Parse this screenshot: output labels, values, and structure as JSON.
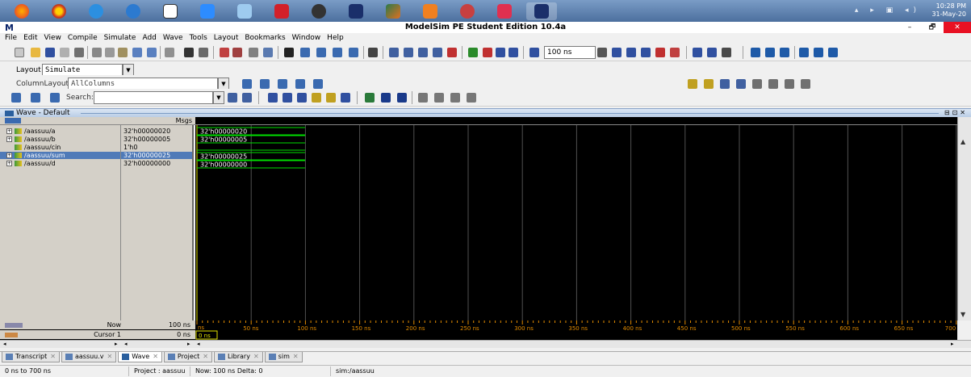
{
  "clock": {
    "time": "10:28 PM",
    "date": "31-May-20"
  },
  "window": {
    "icon": "M",
    "title": "ModelSim PE Student Edition 10.4a",
    "minimize": "–",
    "maximize": "🗗",
    "close": "✕"
  },
  "menu": [
    "File",
    "Edit",
    "View",
    "Compile",
    "Simulate",
    "Add",
    "Wave",
    "Tools",
    "Layout",
    "Bookmarks",
    "Window",
    "Help"
  ],
  "toolbar": {
    "run_length": "100 ns"
  },
  "layout": {
    "label": "Layout",
    "value": "Simulate"
  },
  "column_layout": {
    "label": "ColumnLayout",
    "value": "AllColumns"
  },
  "search": {
    "label": "Search:",
    "value": ""
  },
  "wave_window": {
    "title": "Wave - Default",
    "msgs_header": "Msgs"
  },
  "signals": [
    {
      "name": "/aassuu/a",
      "value": "32'h00000020",
      "wave": "32'h00000020",
      "expandable": true
    },
    {
      "name": "/aassuu/b",
      "value": "32'h00000005",
      "wave": "32'h00000005",
      "expandable": true
    },
    {
      "name": "/aassuu/cin",
      "value": "1'h0",
      "wave": "",
      "expandable": false
    },
    {
      "name": "/aassuu/sum",
      "value": "32'h00000025",
      "wave": "32'h00000025",
      "expandable": true
    },
    {
      "name": "/aassuu/d",
      "value": "32'h00000000",
      "wave": "32'h00000000",
      "expandable": true
    }
  ],
  "now": {
    "label": "Now",
    "value": "100 ns"
  },
  "cursor": {
    "label": "Cursor 1",
    "value": "0 ns",
    "marker": "0 ns"
  },
  "timeline": {
    "ticks": [
      "50 ns",
      "100 ns",
      "150 ns",
      "200 ns",
      "250 ns",
      "300 ns",
      "350 ns",
      "400 ns",
      "450 ns",
      "500 ns",
      "550 ns",
      "600 ns",
      "650 ns",
      "700"
    ],
    "origin": "ns"
  },
  "tabs": [
    {
      "label": "Transcript",
      "active": false
    },
    {
      "label": "aassuu.v",
      "active": false
    },
    {
      "label": "Wave",
      "active": true
    },
    {
      "label": "Project",
      "active": false
    },
    {
      "label": "Library",
      "active": false
    },
    {
      "label": "sim",
      "active": false
    }
  ],
  "status": {
    "range": "0 ns to 700 ns",
    "project": "Project : aassuu",
    "now_delta": "Now: 100 ns  Delta: 0",
    "sim": "sim:/aassuu"
  },
  "colors": {
    "wave_green": "#00e000",
    "cursor_yellow": "#e0e000",
    "grid_gray": "#505050",
    "tick_orange": "#e08a00",
    "selection": "#4f7ab8"
  }
}
